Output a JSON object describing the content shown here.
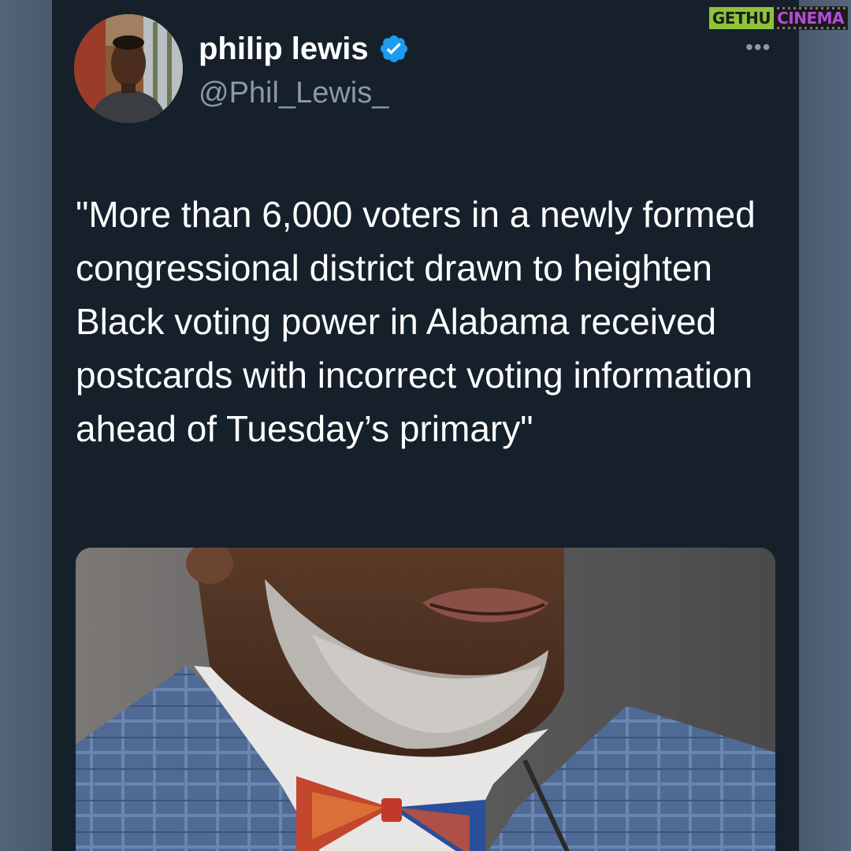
{
  "author": {
    "name": "philip lewis",
    "handle": "@Phil_Lewis_",
    "verified": true
  },
  "tweet": {
    "text": "\"More than 6,000 voters in a newly formed congressional district drawn to heighten Black voting power in Alabama received postcards with incorrect voting information ahead of Tuesday’s primary\""
  },
  "more_menu": "•••",
  "watermark": {
    "left": "GETHU",
    "right": "CINEMA"
  },
  "icons": {
    "verified": "verified-badge-icon",
    "more": "more-options-icon"
  },
  "colors": {
    "background": "#15202b",
    "text": "#ffffff",
    "secondary": "#8b98a5",
    "verified": "#1d9bf0",
    "watermark_left": "#8ec33a",
    "watermark_right": "#b44bd6"
  }
}
